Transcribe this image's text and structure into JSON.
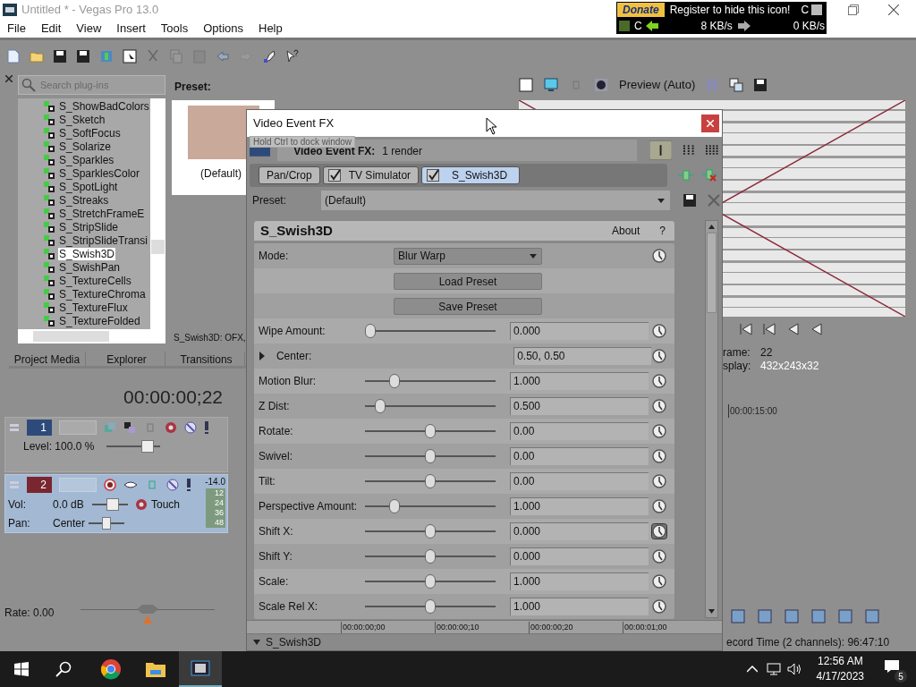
{
  "window": {
    "title": "Untitled * - Vegas Pro 13.0"
  },
  "tray_widget": {
    "donate": "Donate",
    "message": "Register to hide this icon!",
    "drive_top": "C",
    "drive_bottom": "C",
    "download": "8 KB/s",
    "upload": "0 KB/s"
  },
  "menu": [
    "File",
    "Edit",
    "View",
    "Insert",
    "Tools",
    "Options",
    "Help"
  ],
  "plugin_browser": {
    "search_placeholder": "Search plug-ins",
    "items": [
      {
        "label": "S_ShowBadColors",
        "selected": false
      },
      {
        "label": "S_Sketch",
        "selected": false
      },
      {
        "label": "S_SoftFocus",
        "selected": false
      },
      {
        "label": "S_Solarize",
        "selected": false
      },
      {
        "label": "S_Sparkles",
        "selected": false
      },
      {
        "label": "S_SparklesColor",
        "selected": false
      },
      {
        "label": "S_SpotLight",
        "selected": false
      },
      {
        "label": "S_Streaks",
        "selected": false
      },
      {
        "label": "S_StretchFrameE",
        "selected": false
      },
      {
        "label": "S_StripSlide",
        "selected": false
      },
      {
        "label": "S_StripSlideTransi",
        "selected": false
      },
      {
        "label": "S_Swish3D",
        "selected": true
      },
      {
        "label": "S_SwishPan",
        "selected": false
      },
      {
        "label": "S_TextureCells",
        "selected": false
      },
      {
        "label": "S_TextureChroma",
        "selected": false
      },
      {
        "label": "S_TextureFlux",
        "selected": false
      },
      {
        "label": "S_TextureFolded",
        "selected": false
      }
    ],
    "preset_label": "Preset:",
    "preset_name": "(Default)",
    "status": "S_Swish3D: OFX,"
  },
  "tabs": [
    "Project Media",
    "Explorer",
    "Transitions"
  ],
  "preview": {
    "mode": "Preview (Auto)",
    "frame_label": "rame:",
    "frame_value": "22",
    "display_label": "splay:",
    "display_value": "432x243x32"
  },
  "timeline": {
    "time": "00:00:00;22",
    "ruler_mark": "00:00:15:00",
    "rate": "Rate: 0.00",
    "rate_slider": {
      "level": 0.5
    },
    "status": "ecord Time (2 channels): 96:47:10"
  },
  "tracks": [
    {
      "kind": "video",
      "number": "1",
      "level_text": "Level: 100.0 %",
      "level": 0.85
    },
    {
      "kind": "audio",
      "number": "2",
      "vol_label": "Vol:",
      "vol": "0.0 dB",
      "vol_slider": {
        "level": 0.6
      },
      "pan_label": "Pan:",
      "pan": "Center",
      "pan_slider": {
        "level": 0.5
      },
      "automation": "Touch",
      "peak": "-14.0",
      "meter_marks": [
        "12",
        "24",
        "36",
        "48"
      ]
    }
  ],
  "dialog": {
    "title": "Video Event FX",
    "tooltip": "Hold Ctrl to dock window",
    "header_label": "Video Event FX:",
    "header_value": "1 render",
    "chain": [
      {
        "kind": "plain",
        "label": "Pan/Crop",
        "selected": false
      },
      {
        "kind": "toggle",
        "label": "TV Simulator",
        "checked": true,
        "selected": false
      },
      {
        "kind": "toggle",
        "label": "S_Swish3D",
        "checked": true,
        "selected": true
      }
    ],
    "preset_label": "Preset:",
    "preset_value": "(Default)",
    "plugin": {
      "name": "S_Swish3D",
      "about": "About",
      "help": "?",
      "rows": [
        {
          "kind": "dropdown",
          "label": "Mode:",
          "value": "Blur Warp"
        },
        {
          "kind": "button",
          "label": "Load Preset"
        },
        {
          "kind": "button",
          "label": "Save Preset"
        },
        {
          "kind": "slider",
          "label": "Wipe Amount:",
          "level": 0,
          "value": "0.000",
          "keyframe_selected": false
        },
        {
          "kind": "group",
          "label": "Center:",
          "expanded": false,
          "value": "0.50, 0.50"
        },
        {
          "kind": "slider",
          "label": "Motion Blur:",
          "level": 0.2,
          "value": "1.000",
          "keyframe_selected": false
        },
        {
          "kind": "slider",
          "label": "Z Dist:",
          "level": 0.08,
          "value": "0.500",
          "keyframe_selected": false
        },
        {
          "kind": "slider",
          "label": "Rotate:",
          "level": 0.5,
          "value": "0.00",
          "keyframe_selected": false
        },
        {
          "kind": "slider",
          "label": "Swivel:",
          "level": 0.5,
          "value": "0.00",
          "keyframe_selected": false
        },
        {
          "kind": "slider",
          "label": "Tilt:",
          "level": 0.5,
          "value": "0.00",
          "keyframe_selected": false
        },
        {
          "kind": "slider",
          "label": "Perspective Amount:",
          "level": 0.2,
          "value": "1.000",
          "keyframe_selected": false
        },
        {
          "kind": "slider",
          "label": "Shift X:",
          "level": 0.5,
          "value": "0.000",
          "keyframe_selected": true
        },
        {
          "kind": "slider",
          "label": "Shift Y:",
          "level": 0.5,
          "value": "0.000",
          "keyframe_selected": false
        },
        {
          "kind": "slider",
          "label": "Scale:",
          "level": 0.5,
          "value": "1.000",
          "keyframe_selected": false
        },
        {
          "kind": "slider",
          "label": "Scale Rel X:",
          "level": 0.5,
          "value": "1.000",
          "keyframe_selected": false
        }
      ]
    },
    "ruler": [
      "00:00:00;00",
      "00:00:00;10",
      "00:00:00;20",
      "00:00:01;00"
    ],
    "track_label": "S_Swish3D"
  },
  "taskbar": {
    "time": "12:56 AM",
    "date": "4/17/2023",
    "notifications": "5"
  }
}
